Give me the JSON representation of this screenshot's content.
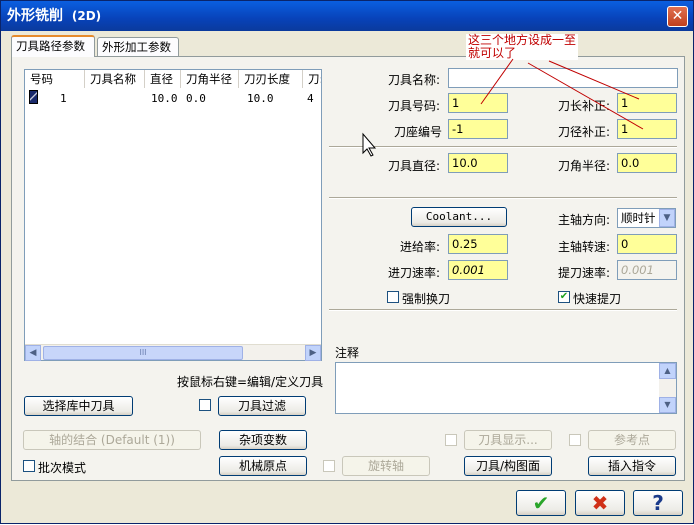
{
  "window": {
    "title": "外形铣削",
    "title_suffix": "(2D)",
    "close_glyph": "✕"
  },
  "tabs": [
    {
      "label": "刀具路径参数"
    },
    {
      "label": "外形加工参数"
    }
  ],
  "tool_list": {
    "columns": [
      "号码",
      "刀具名称",
      "直径",
      "刀角半径",
      "刀刃长度",
      "刀:"
    ],
    "rows": [
      {
        "number": "1",
        "name": "",
        "diameter": "10.0",
        "corner_radius": "0.0",
        "flute_length": "10.0",
        "extra": "4"
      }
    ],
    "scroll_mid": "III"
  },
  "hint": "按鼠标右键=编辑/定义刀具",
  "buttons": {
    "select_lib": "选择库中刀具",
    "filter": "刀具过滤",
    "axis": "轴的结合 (Default (1))",
    "misc": "杂项变数",
    "machine_origin": "机械原点",
    "rotary": "旋转轴",
    "tool_plane": "刀具/构图面",
    "tool_display": "刀具显示...",
    "ref_point": "参考点",
    "insert": "插入指令",
    "coolant": "Coolant..."
  },
  "checkboxes": {
    "filter": "",
    "batch": "批次模式",
    "rotary": "",
    "tool_display": "",
    "ref_point": "",
    "force_change": "强制换刀",
    "rapid_retract": "快速提刀"
  },
  "fields": {
    "tool_name": {
      "label": "刀具名称:",
      "value": ""
    },
    "tool_number": {
      "label": "刀具号码:",
      "value": "1"
    },
    "head_number": {
      "label": "刀座编号",
      "value": "-1"
    },
    "tool_diameter": {
      "label": "刀具直径:",
      "value": "10.0"
    },
    "length_comp": {
      "label": "刀长补正:",
      "value": "1"
    },
    "dia_comp": {
      "label": "刀径补正:",
      "value": "1"
    },
    "corner_radius": {
      "label": "刀角半径:",
      "value": "0.0"
    },
    "spindle_dir": {
      "label": "主轴方向:",
      "value": "顺时针"
    },
    "feed_rate": {
      "label": "进给率:",
      "value": "0.25"
    },
    "spindle_speed": {
      "label": "主轴转速:",
      "value": "0"
    },
    "plunge_rate": {
      "label": "进刀速率:",
      "value": "0.001"
    },
    "retract_rate": {
      "label": "提刀速率:",
      "value": "0.001"
    }
  },
  "notes_label": "注释",
  "annotation": {
    "line1": "这三个地方设成一至",
    "line2": "就可以了"
  },
  "footer": {
    "ok": "✔",
    "cancel": "✖",
    "help": "?"
  },
  "colors": {
    "title": "#0842b8",
    "field": "#ffff99",
    "annotation": "#c00000"
  }
}
